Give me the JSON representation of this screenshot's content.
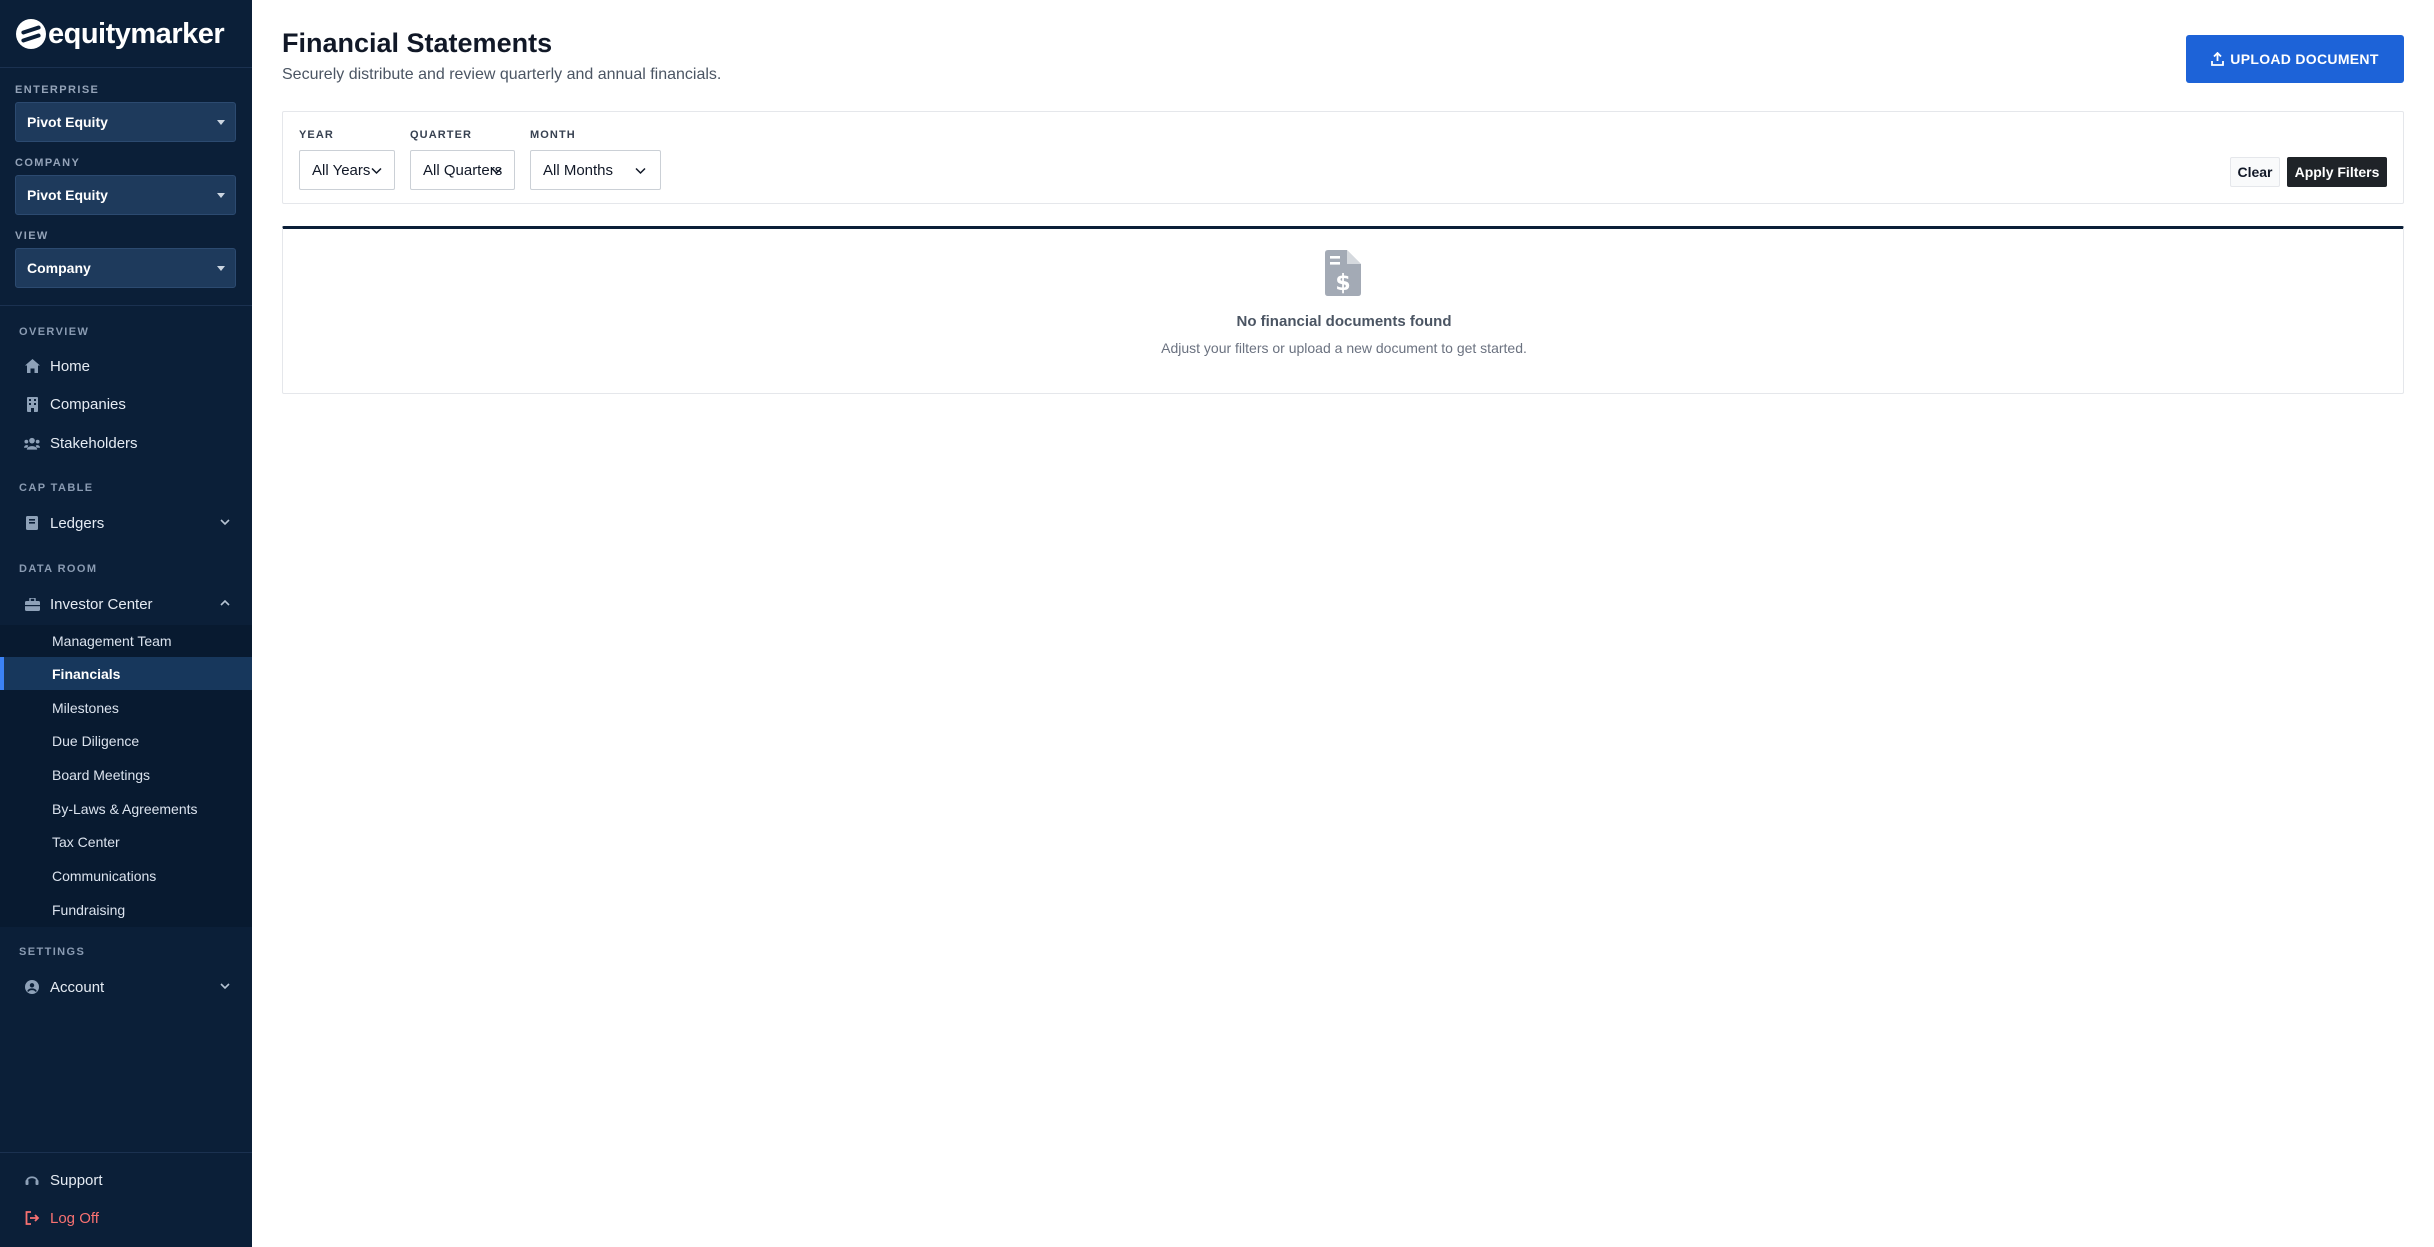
{
  "brand": {
    "name": "equitymarker"
  },
  "sidebar": {
    "selectors": [
      {
        "label": "ENTERPRISE",
        "value": "Pivot Equity"
      },
      {
        "label": "COMPANY",
        "value": "Pivot Equity"
      },
      {
        "label": "VIEW",
        "value": "Company"
      }
    ],
    "sections": {
      "overview": "OVERVIEW",
      "cap_table": "CAP TABLE",
      "data_room": "DATA ROOM",
      "settings": "SETTINGS"
    },
    "nav": {
      "home": "Home",
      "companies": "Companies",
      "stakeholders": "Stakeholders",
      "ledgers": "Ledgers",
      "investor_center": "Investor Center",
      "account": "Account"
    },
    "investor_center_items": [
      "Management Team",
      "Financials",
      "Milestones",
      "Due Diligence",
      "Board Meetings",
      "By-Laws & Agreements",
      "Tax Center",
      "Communications",
      "Fundraising"
    ],
    "active_item": "Financials",
    "footer": {
      "support": "Support",
      "logoff": "Log Off"
    }
  },
  "header": {
    "title": "Financial Statements",
    "subtitle": "Securely distribute and review quarterly and annual financials.",
    "upload_label": "UPLOAD DOCUMENT"
  },
  "filters": {
    "year": {
      "label": "YEAR",
      "value": "All Years"
    },
    "quarter": {
      "label": "QUARTER",
      "value": "All Quarters"
    },
    "month": {
      "label": "MONTH",
      "value": "All Months"
    },
    "clear_label": "Clear",
    "apply_label": "Apply Filters"
  },
  "empty_state": {
    "title": "No financial documents found",
    "message": "Adjust your filters or upload a new document to get started."
  },
  "colors": {
    "sidebar_bg": "#0b1f38",
    "primary": "#1d63d8",
    "active_accent": "#3b82f6",
    "logoff": "#f87171"
  }
}
